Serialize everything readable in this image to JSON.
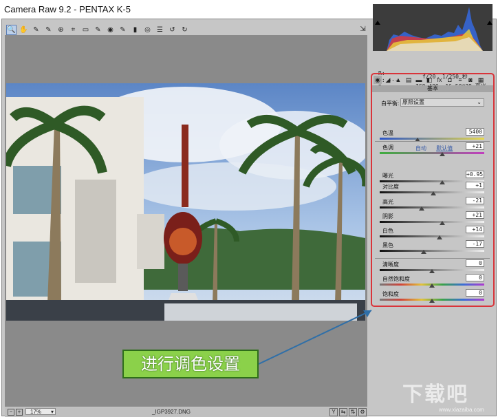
{
  "window": {
    "title": "Camera Raw 9.2 -  PENTAX K-5"
  },
  "toolbar": {
    "tools": [
      {
        "name": "zoom-tool",
        "glyph": "🔍"
      },
      {
        "name": "hand-tool",
        "glyph": "✋"
      },
      {
        "name": "white-balance-tool",
        "glyph": "✎"
      },
      {
        "name": "color-sampler-tool",
        "glyph": "✎"
      },
      {
        "name": "targeted-adjustment-tool",
        "glyph": "⊕"
      },
      {
        "name": "crop-tool",
        "glyph": "⌗"
      },
      {
        "name": "straighten-tool",
        "glyph": "▭"
      },
      {
        "name": "spot-removal-tool",
        "glyph": "✎"
      },
      {
        "name": "red-eye-tool",
        "glyph": "◉"
      },
      {
        "name": "adjustment-brush-tool",
        "glyph": "✎"
      },
      {
        "name": "graduated-filter-tool",
        "glyph": "▮"
      },
      {
        "name": "radial-filter-tool",
        "glyph": "◎"
      },
      {
        "name": "preferences-tool",
        "glyph": "☰"
      },
      {
        "name": "rotate-ccw-tool",
        "glyph": "↺"
      },
      {
        "name": "rotate-cw-tool",
        "glyph": "↻"
      }
    ],
    "fullscreen_glyph": "⇲"
  },
  "status": {
    "zoom": "17%",
    "filename": "_IGP3927.DNG"
  },
  "info": {
    "r_label": "R:",
    "g_label": "G:",
    "b_label": "B:",
    "r_val": "---",
    "g_val": "---",
    "b_val": "---",
    "aperture": "f/20",
    "shutter": "1/250 秒",
    "iso": "ISO 400",
    "lens": "16-50@39 毫米"
  },
  "panel_tabs": [
    "◉",
    "◢",
    "▲",
    "▤",
    "▬",
    "◧",
    "fx",
    "◘",
    "≡",
    "◙",
    "▦"
  ],
  "basic": {
    "title": "基本",
    "wb_label": "白平衡:",
    "wb_value": "原照设置",
    "auto": "自动",
    "default": "默认值",
    "sliders": [
      {
        "key": "temp",
        "label": "色温",
        "value": "5400",
        "pos": 0.36
      },
      {
        "key": "tint",
        "label": "色调",
        "value": "+21",
        "pos": 0.6
      },
      {
        "key": "exposure",
        "label": "曝光",
        "value": "+0.95",
        "pos": 0.6
      },
      {
        "key": "contrast",
        "label": "对比度",
        "value": "+1",
        "pos": 0.51
      },
      {
        "key": "highlights",
        "label": "高光",
        "value": "-21",
        "pos": 0.4
      },
      {
        "key": "shadows",
        "label": "阴影",
        "value": "+21",
        "pos": 0.6
      },
      {
        "key": "whites",
        "label": "白色",
        "value": "+14",
        "pos": 0.57
      },
      {
        "key": "blacks",
        "label": "黑色",
        "value": "-17",
        "pos": 0.42
      },
      {
        "key": "clarity",
        "label": "清晰度",
        "value": "0",
        "pos": 0.5
      },
      {
        "key": "vibrance",
        "label": "自然饱和度",
        "value": "0",
        "pos": 0.5
      },
      {
        "key": "saturation",
        "label": "饱和度",
        "value": "0",
        "pos": 0.5
      }
    ]
  },
  "callout": {
    "text": "进行调色设置"
  },
  "watermark": {
    "text": "下载吧",
    "url": "www.xiazaiba.com"
  },
  "colors": {
    "highlight_border": "#d9343a",
    "callout_bg": "#8bd14a",
    "arrow": "#2f6fa8"
  }
}
